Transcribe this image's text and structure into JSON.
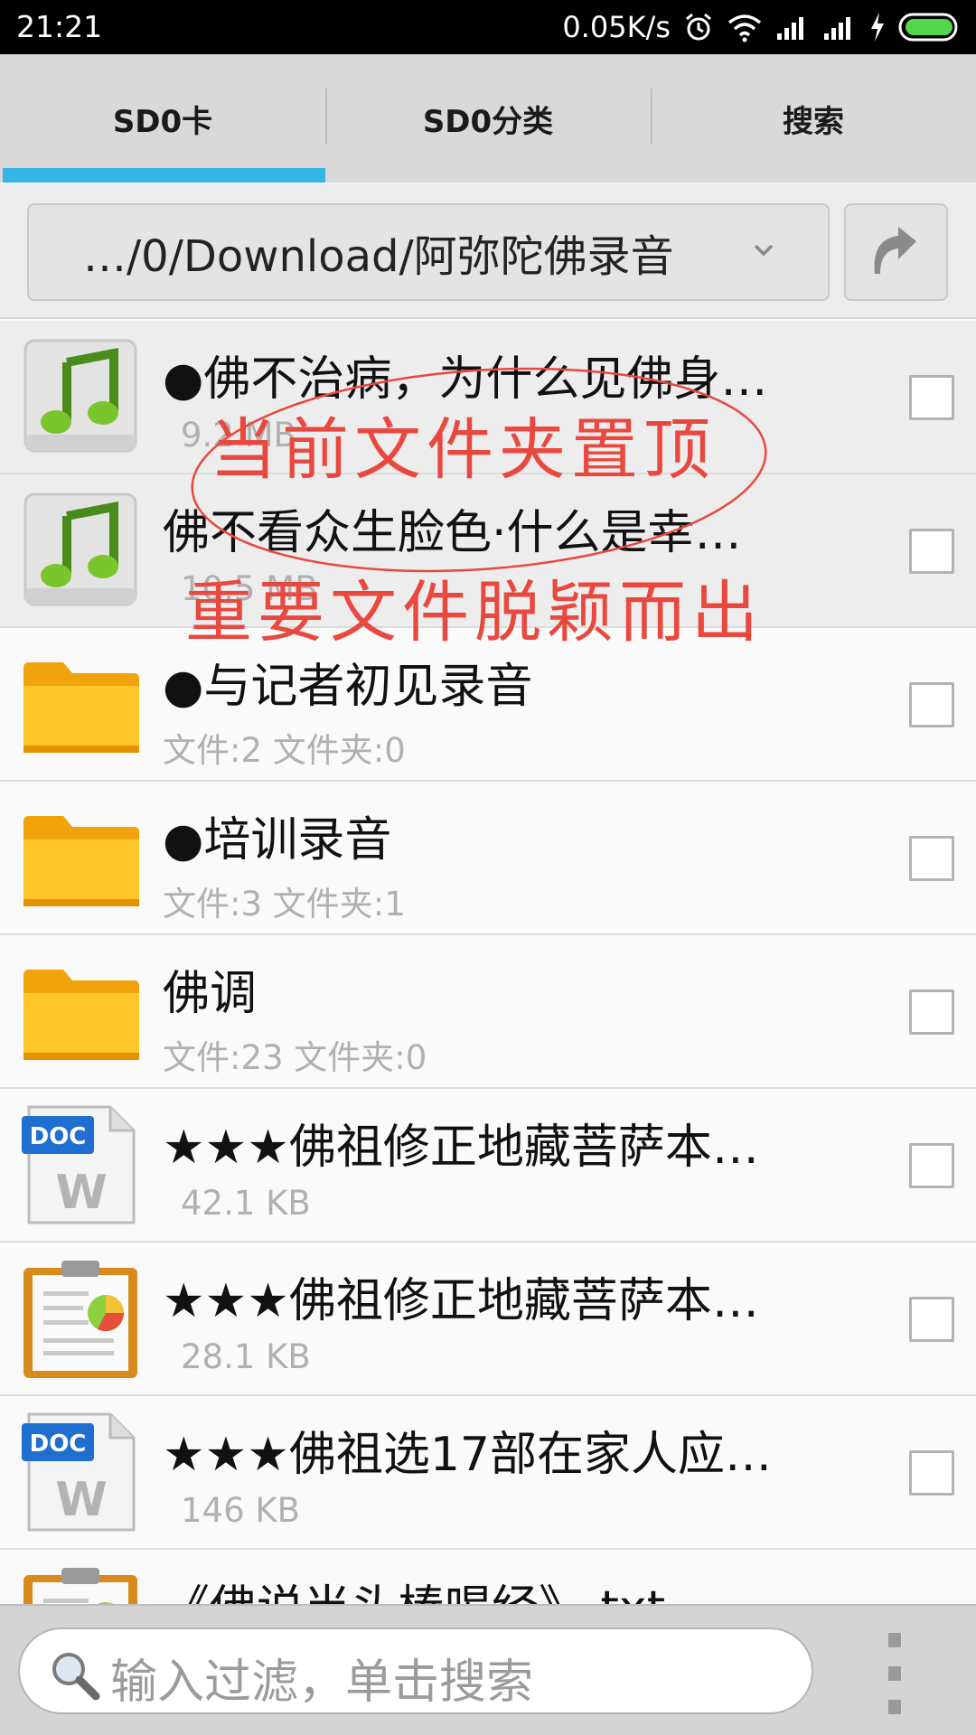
{
  "status_bar": {
    "time": "21:21",
    "net_speed": "0.05K/s",
    "battery_color": "#52d64a"
  },
  "tabs": [
    {
      "label": "SD0卡",
      "active": true
    },
    {
      "label": "SD0分类",
      "active": false
    },
    {
      "label": "搜索",
      "active": false
    }
  ],
  "accent_color": "#33b5e5",
  "path": "…/0/Download/阿弥陀佛录音",
  "files": [
    {
      "title": "●佛不治病，为什么见佛身…",
      "sub": "9.2 MB",
      "icon": "music-icon",
      "pinned": true
    },
    {
      "title": "佛不看众生脸色·什么是幸…",
      "sub": "10.5 MB",
      "icon": "music-icon",
      "pinned": true
    },
    {
      "title": "●与记者初见录音",
      "sub": "文件:2  文件夹:0",
      "icon": "folder-icon",
      "pinned": false
    },
    {
      "title": "●培训录音",
      "sub": "文件:3  文件夹:1",
      "icon": "folder-icon",
      "pinned": false
    },
    {
      "title": "佛调",
      "sub": "文件:23  文件夹:0",
      "icon": "folder-icon",
      "pinned": false
    },
    {
      "title": "★★★佛祖修正地藏菩萨本…",
      "sub": "42.1 KB",
      "icon": "doc-icon",
      "pinned": false
    },
    {
      "title": "★★★佛祖修正地藏菩萨本…",
      "sub": "28.1 KB",
      "icon": "clipboard-chart-icon",
      "pinned": false
    },
    {
      "title": "★★★佛祖选17部在家人应…",
      "sub": "146 KB",
      "icon": "doc-icon",
      "pinned": false
    },
    {
      "title": "《佛说当头棒喝经》.txt",
      "sub": "",
      "icon": "clipboard-chart-icon",
      "pinned": false
    }
  ],
  "annotations": {
    "line1": "当前文件夹置顶",
    "line2": "重要文件脱颖而出",
    "color": "#e8483e"
  },
  "search": {
    "placeholder": "输入过滤，单击搜索"
  }
}
